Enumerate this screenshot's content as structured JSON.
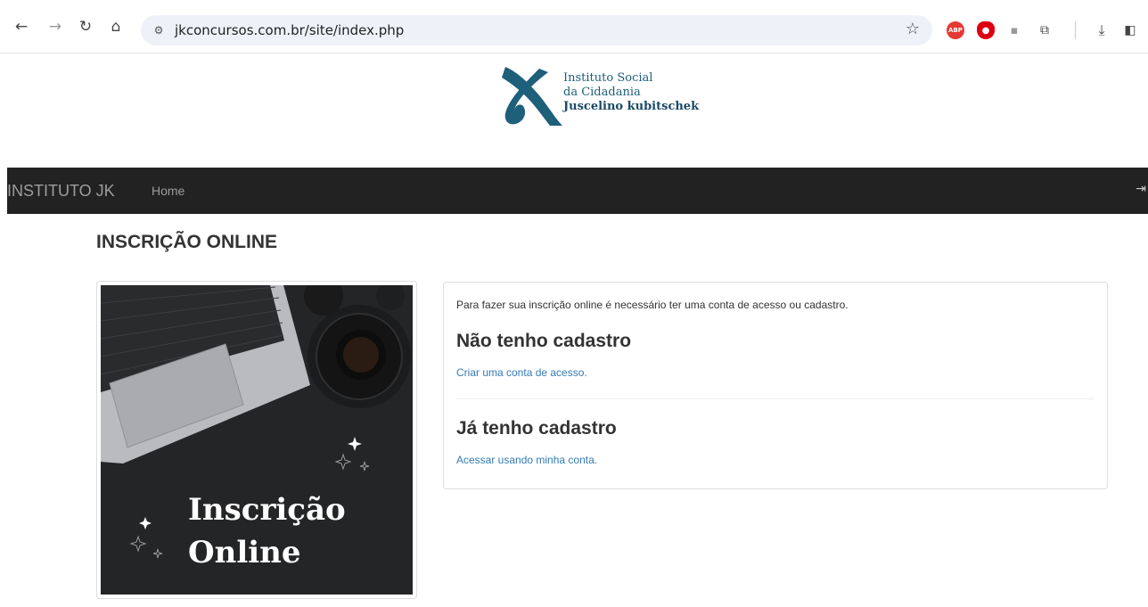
{
  "browser": {
    "url": "jkconcursos.com.br/site/index.php",
    "icons": [
      "back-icon",
      "forward-icon",
      "reload-icon",
      "home-icon",
      "site-info-icon",
      "bookmark-star-icon",
      "adblock-plus-icon",
      "ublock-icon",
      "extension-icon",
      "extensions-puzzle-icon",
      "download-icon",
      "sidepanel-icon"
    ],
    "abp_label": "ABP"
  },
  "logo": {
    "line1": "Instituto Social",
    "line2": "da Cidadania",
    "line3": "Juscelino kubitschek",
    "colors": {
      "mark": "#1e5f7a",
      "mark_light": "#2a7aa0"
    }
  },
  "navbar": {
    "brand": "INSTITUTO JK",
    "home": "Home",
    "background": "#222222"
  },
  "main": {
    "title": "INSCRIÇÃO ONLINE",
    "image_caption_line1": "Inscrição",
    "image_caption_line2": "Online",
    "panel": {
      "intro": "Para fazer sua inscrição online é necessário ter uma conta de acesso ou cadastro.",
      "no_account_heading": "Não tenho cadastro",
      "no_account_link": "Criar uma conta de acesso.",
      "has_account_heading": "Já tenho cadastro",
      "has_account_link": "Acessar usando minha conta."
    },
    "link_color": "#337ab7"
  }
}
